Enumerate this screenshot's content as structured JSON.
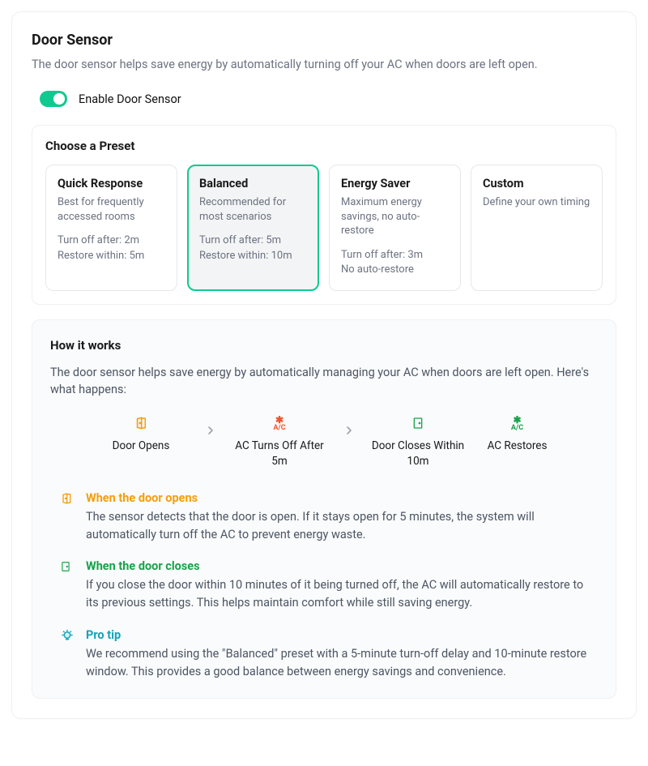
{
  "header": {
    "title": "Door Sensor",
    "subtitle": "The door sensor helps save energy by automatically turning off your AC when doors are left open."
  },
  "toggle": {
    "label": "Enable Door Sensor",
    "enabled": true
  },
  "presets": {
    "title": "Choose a Preset",
    "items": [
      {
        "name": "Quick Response",
        "desc": "Best for frequently accessed rooms",
        "line1": "Turn off after: 2m",
        "line2": "Restore within: 5m",
        "selected": false
      },
      {
        "name": "Balanced",
        "desc": "Recommended for most scenarios",
        "line1": "Turn off after: 5m",
        "line2": "Restore within: 10m",
        "selected": true
      },
      {
        "name": "Energy Saver",
        "desc": "Maximum energy savings, no auto-restore",
        "line1": "Turn off after: 3m",
        "line2": "No auto-restore",
        "selected": false
      },
      {
        "name": "Custom",
        "desc": "Define your own timing",
        "line1": "",
        "line2": "",
        "selected": false
      }
    ]
  },
  "how": {
    "title": "How it works",
    "intro": "The door sensor helps save energy by automatically managing your AC when doors are left open. Here's what happens:",
    "steps": [
      {
        "label": "Door Opens"
      },
      {
        "label": "AC Turns Off After 5m"
      },
      {
        "label": "Door Closes Within 10m"
      },
      {
        "label": "AC Restores"
      }
    ],
    "tips": [
      {
        "title": "When the door opens",
        "body": "The sensor detects that the door is open. If it stays open for 5 minutes, the system will automatically turn off the AC to prevent energy waste.",
        "color": "orange",
        "icon": "door-open"
      },
      {
        "title": "When the door closes",
        "body": "If you close the door within 10 minutes of it being turned off, the AC will automatically restore to its previous settings. This helps maintain comfort while still saving energy.",
        "color": "green",
        "icon": "door-closed"
      },
      {
        "title": "Pro tip",
        "body": "We recommend using the \"Balanced\" preset with a 5-minute turn-off delay and 10-minute restore window. This provides a good balance between energy savings and convenience.",
        "color": "teal",
        "icon": "lightbulb"
      }
    ]
  },
  "colors": {
    "accent": "#10c990",
    "orange": "#f59e0b",
    "green": "#16a34a",
    "teal": "#0ea5b7"
  }
}
